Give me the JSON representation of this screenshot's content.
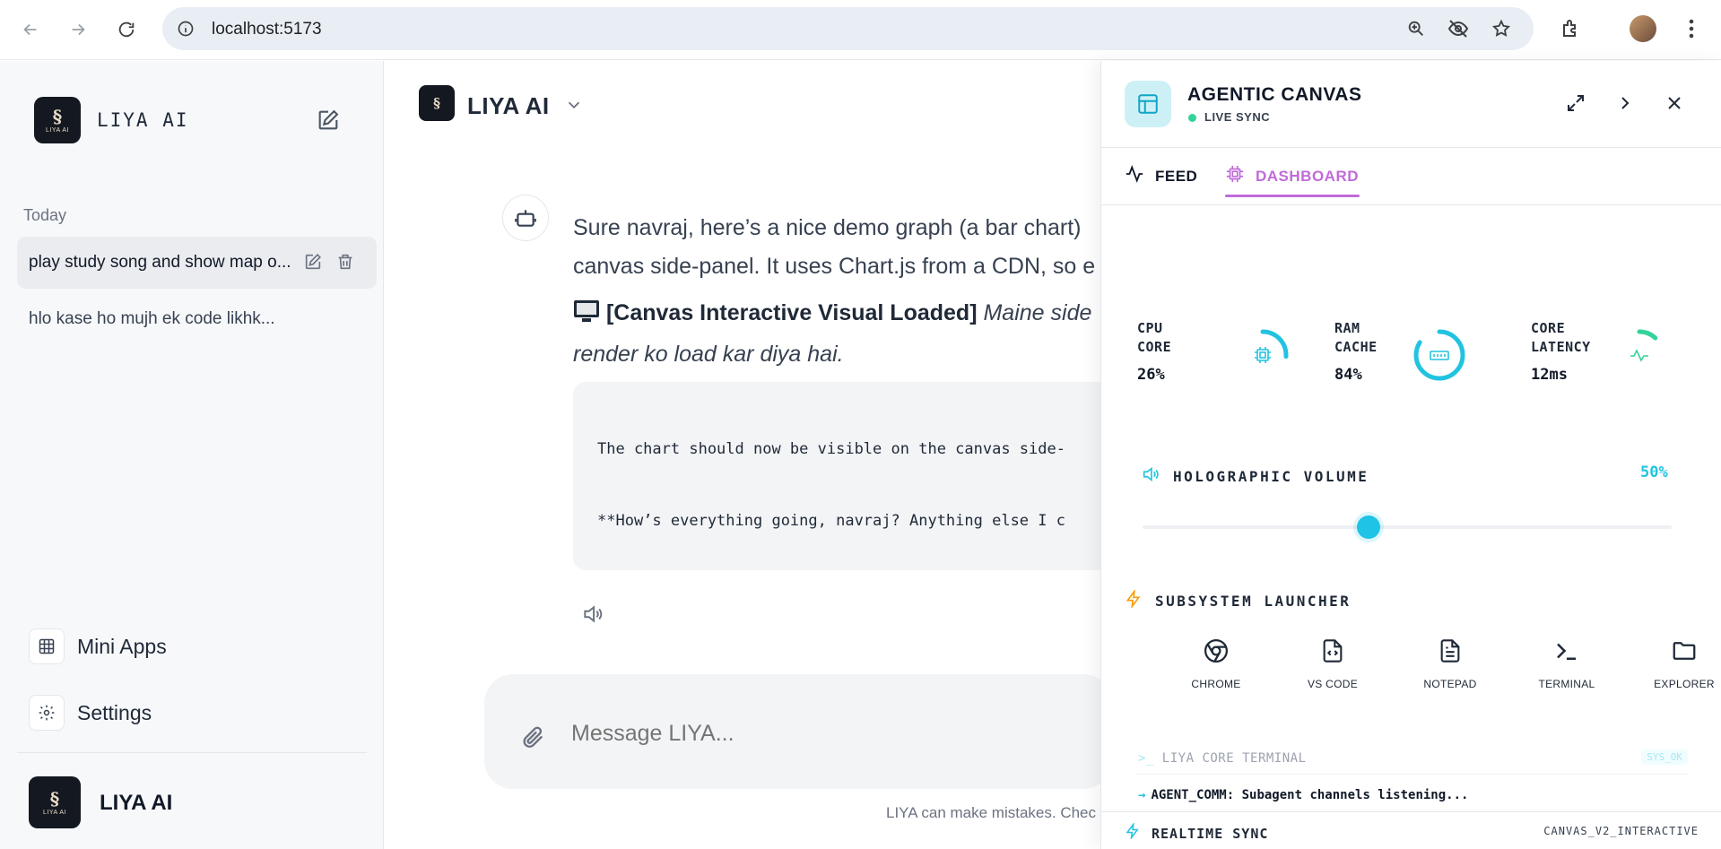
{
  "browser": {
    "url": "localhost:5173"
  },
  "sidebar": {
    "brand": "LIYA AI",
    "logo_caption": "LIYA AI",
    "section_today": "Today",
    "history": [
      {
        "label": "play study song and show map o..."
      },
      {
        "label": "hlo kase ho mujh ek code likhk..."
      }
    ],
    "links": [
      {
        "label": "Mini Apps",
        "icon": "grid-icon"
      },
      {
        "label": "Settings",
        "icon": "gear-icon"
      }
    ],
    "footer_name": "LIYA AI"
  },
  "chat": {
    "model_name": "LIYA AI",
    "message_line1": "Sure navraj, here’s a nice demo graph (a bar chart)",
    "message_line2": "canvas side-panel. It uses Chart.js from a CDN, so e",
    "visual_tag": "[Canvas Interactive Visual Loaded]",
    "visual_italic1": " Maine side",
    "visual_italic2": "render ko load kar diya hai.",
    "code_line1": "The chart should now be visible on the canvas side-",
    "code_line2": "**How’s everything going, navraj? Anything else I c",
    "composer_placeholder": "Message LIYA...",
    "disclaimer": "LIYA can make mistakes. Chec"
  },
  "canvas": {
    "title": "AGENTIC CANVAS",
    "status": "LIVE SYNC",
    "tabs": [
      {
        "label": "FEED",
        "active": false
      },
      {
        "label": "DASHBOARD",
        "active": true
      }
    ],
    "stats": [
      {
        "label_line1": "CPU",
        "label_line2": "CORE",
        "value": "26%",
        "fraction": 0.26,
        "color": "#22c3e0"
      },
      {
        "label_line1": "RAM",
        "label_line2": "CACHE",
        "value": "84%",
        "fraction": 0.84,
        "color": "#22c3e0"
      },
      {
        "label_line1": "CORE",
        "label_line2": "LATENCY",
        "value": "12ms",
        "fraction": 0.12,
        "color": "#34d399"
      }
    ],
    "volume": {
      "title": "HOLOGRAPHIC VOLUME",
      "value_label": "50%",
      "fraction": 0.5
    },
    "launcher": {
      "title": "SUBSYSTEM LAUNCHER",
      "apps": [
        {
          "label": "CHROME",
          "icon": "chrome-icon"
        },
        {
          "label": "VS CODE",
          "icon": "code-file-icon"
        },
        {
          "label": "NOTEPAD",
          "icon": "notepad-icon"
        },
        {
          "label": "TERMINAL",
          "icon": "terminal-icon"
        },
        {
          "label": "EXPLORER",
          "icon": "folder-icon"
        }
      ]
    },
    "terminal": {
      "title": "LIYA CORE TERMINAL",
      "badge": "SYS_OK",
      "line": "AGENT_COMM: Subagent channels listening..."
    },
    "footer": {
      "title": "REALTIME SYNC",
      "right": "CANVAS_V2_INTERACTIVE"
    },
    "accent_color": "#22c3e0",
    "tab_accent_color": "#c06bd9"
  }
}
